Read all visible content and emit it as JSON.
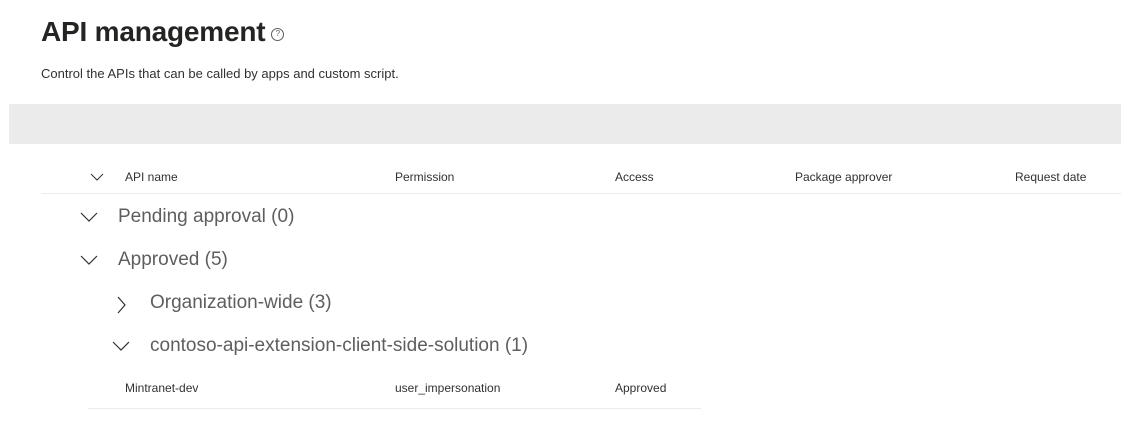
{
  "page": {
    "title": "API management",
    "subtitle": "Control the APIs that can be called by apps and custom script."
  },
  "table": {
    "columns": [
      "API name",
      "Permission",
      "Access",
      "Package approver",
      "Request date"
    ],
    "groups": [
      {
        "label": "Pending approval (0)",
        "expanded": true
      },
      {
        "label": "Approved (5)",
        "expanded": true
      },
      {
        "label": "Organization-wide (3)",
        "expanded": false
      },
      {
        "label": "contoso-api-extension-client-side-solution (1)",
        "expanded": true
      }
    ],
    "rows": [
      {
        "api_name": "Mintranet-dev",
        "permission": "user_impersonation",
        "access": "Approved",
        "package_approver": "",
        "request_date": ""
      }
    ]
  },
  "icons": {
    "help": "help-circle-icon",
    "chevron_down": "chevron-down-icon",
    "chevron_right": "chevron-right-icon"
  },
  "colors": {
    "command_bar": "#ebebeb",
    "group_text": "#605e5c",
    "divider": "#edebe9"
  }
}
